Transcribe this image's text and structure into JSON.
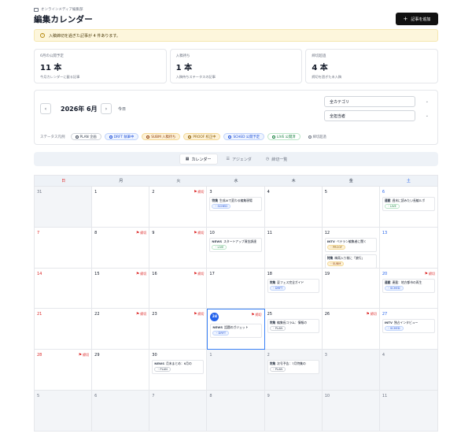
{
  "header": {
    "org": "オンラインメディア編集部",
    "title": "編集カレンダー",
    "add_button": "記事を追加"
  },
  "alert": {
    "text": "入稿締切を過ぎた記事が 4 件あります。"
  },
  "stats": [
    {
      "label": "6月の公開予定",
      "value": "11 本",
      "note": "今月カレンダーに載る記事"
    },
    {
      "label": "入稿待ち",
      "value": "1 本",
      "note": "入稿待ちステータスの記事"
    },
    {
      "label": "締切超過",
      "value": "4 本",
      "note": "締切を過ぎた未入稿"
    }
  ],
  "filter": {
    "prev": "‹",
    "next": "›",
    "month": "2026年 6月",
    "today": "今日",
    "category": "全カテゴリ",
    "assignee": "全担当者",
    "status_label": "ステータス凡例",
    "statuses": [
      {
        "label": "PLAN 企画",
        "color": "#374151",
        "bg": "#ffffff",
        "border": "#d1d5db"
      },
      {
        "label": "DRFT 執筆中",
        "color": "#1d4ed8",
        "bg": "#eef4ff",
        "border": "#bfd3fb"
      },
      {
        "label": "SUBM 入稿待ち",
        "color": "#92400e",
        "bg": "#fdf1d6",
        "border": "#f3d894"
      },
      {
        "label": "PROOF 校正中",
        "color": "#8a5a00",
        "bg": "#fdf1d6",
        "border": "#f3d894"
      },
      {
        "label": "SCHED 公開予定",
        "color": "#1d4ed8",
        "bg": "#eef4ff",
        "border": "#bfd3fb"
      },
      {
        "label": "LIVE 公開済",
        "color": "#15803d",
        "bg": "#ffffff",
        "border": "#bbe5c8"
      },
      {
        "label": "締切超過",
        "color": "#6b7280",
        "bg": "#ffffff",
        "border": "#ffffff"
      }
    ]
  },
  "tabs": [
    {
      "label": "カレンダー",
      "icon": "calendar-icon",
      "active": true
    },
    {
      "label": "アジェンダ",
      "icon": "list-icon",
      "active": false
    },
    {
      "label": "締切一覧",
      "icon": "clock-icon",
      "active": false
    }
  ],
  "weekdays": [
    "日",
    "月",
    "火",
    "水",
    "木",
    "金",
    "土"
  ],
  "deadline_label": "締切",
  "days": [
    {
      "num": "31",
      "outside": true
    },
    {
      "num": "1"
    },
    {
      "num": "2",
      "deadline": true
    },
    {
      "num": "3",
      "events": [
        {
          "cat": "特集",
          "title": "生成AIで変わる編集現場",
          "status": "SCHED"
        }
      ]
    },
    {
      "num": "4"
    },
    {
      "num": "5"
    },
    {
      "num": "6",
      "events": [
        {
          "cat": "連載",
          "title": "週末に読みたい長編ルポ",
          "status": "LIVE"
        }
      ]
    },
    {
      "num": "7"
    },
    {
      "num": "8",
      "deadline": true
    },
    {
      "num": "9",
      "deadline": true
    },
    {
      "num": "10",
      "events": [
        {
          "cat": "NEWS",
          "title": "スタートアップ資金調達",
          "status": "LIVE"
        }
      ]
    },
    {
      "num": "11"
    },
    {
      "num": "12",
      "events": [
        {
          "cat": "INTV",
          "title": "ベテラン編集者に聞く",
          "status": "PROOF"
        },
        {
          "cat": "特集",
          "title": "梅雨入り前に「旅行」",
          "status": "SUBM"
        }
      ]
    },
    {
      "num": "13"
    },
    {
      "num": "14"
    },
    {
      "num": "15",
      "deadline": true
    },
    {
      "num": "16",
      "deadline": true
    },
    {
      "num": "17"
    },
    {
      "num": "18",
      "events": [
        {
          "cat": "特集",
          "title": "夏フェス完全ガイド",
          "status": "DRFT"
        }
      ]
    },
    {
      "num": "19"
    },
    {
      "num": "20",
      "deadline": true,
      "events": [
        {
          "cat": "連載",
          "title": "連載：地方都市の再生",
          "status": "SCHED"
        }
      ]
    },
    {
      "num": "21"
    },
    {
      "num": "22",
      "deadline": true
    },
    {
      "num": "23",
      "deadline": true
    },
    {
      "num": "24",
      "today": true,
      "deadline": true,
      "events": [
        {
          "cat": "NEWS",
          "title": "話題のガジェット",
          "status": "DRFT"
        }
      ]
    },
    {
      "num": "25",
      "events": [
        {
          "cat": "特集",
          "title": "編集長コラム：情報の",
          "status": "PLAN"
        }
      ]
    },
    {
      "num": "26",
      "deadline": true
    },
    {
      "num": "27",
      "events": [
        {
          "cat": "INTV",
          "title": "独占インタビュー",
          "status": "SCHED"
        }
      ]
    },
    {
      "num": "28",
      "deadline": true
    },
    {
      "num": "29"
    },
    {
      "num": "30",
      "events": [
        {
          "cat": "NEWS",
          "title": "月末まとめ：6月の",
          "status": "PLAN"
        }
      ]
    },
    {
      "num": "1",
      "outside": true
    },
    {
      "num": "2",
      "outside": true,
      "events": [
        {
          "cat": "特集",
          "title": "次号予告：7月特集の",
          "status": "PLAN"
        }
      ]
    },
    {
      "num": "3",
      "outside": true
    },
    {
      "num": "4",
      "outside": true
    },
    {
      "num": "5",
      "outside": true
    },
    {
      "num": "6",
      "outside": true
    },
    {
      "num": "7",
      "outside": true
    },
    {
      "num": "8",
      "outside": true
    },
    {
      "num": "9",
      "outside": true
    },
    {
      "num": "10",
      "outside": true
    },
    {
      "num": "11",
      "outside": true
    }
  ],
  "status_styles": {
    "PLAN": {
      "color": "#374151",
      "bg": "#ffffff",
      "border": "#d1d5db"
    },
    "DRFT": {
      "color": "#1d4ed8",
      "bg": "#eef4ff",
      "border": "#bfd3fb"
    },
    "SUBM": {
      "color": "#92400e",
      "bg": "#fdf1d6",
      "border": "#f3d894"
    },
    "PROOF": {
      "color": "#8a5a00",
      "bg": "#fdf1d6",
      "border": "#f3d894"
    },
    "SCHED": {
      "color": "#1d4ed8",
      "bg": "#eef4ff",
      "border": "#bfd3fb"
    },
    "LIVE": {
      "color": "#15803d",
      "bg": "#ffffff",
      "border": "#bbe5c8"
    }
  }
}
